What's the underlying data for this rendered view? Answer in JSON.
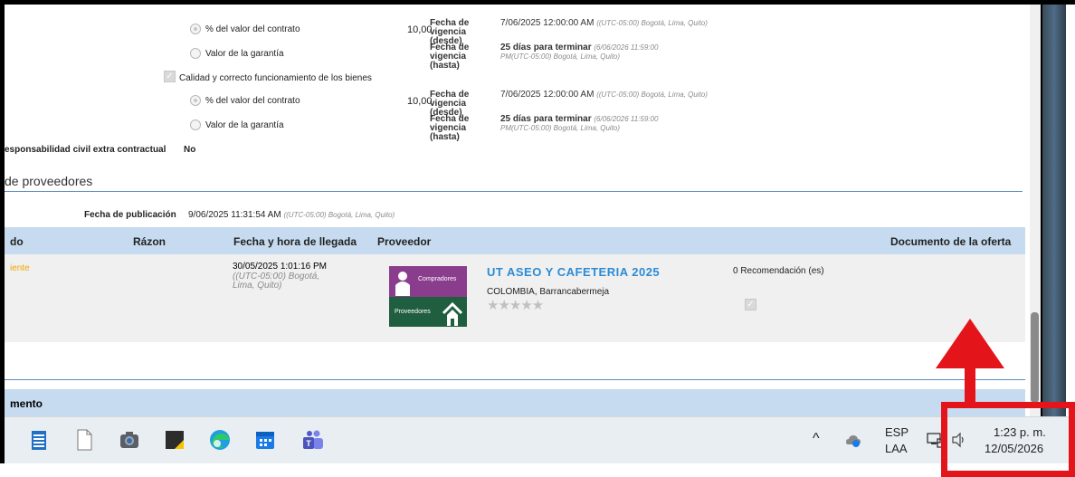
{
  "guarantees": {
    "block1": {
      "opt1_label": "% del valor del contrato",
      "opt2_label": "Valor de la garantía",
      "value": "10,00",
      "from_label": "Fecha de vigencia (desde)",
      "from_date": "7/06/2025 12:00:00 AM",
      "from_tz": "((UTC-05:00) Bogotá, Lima, Quito)",
      "to_label": "Fecha de vigencia (hasta)",
      "to_value": "25 días para terminar",
      "to_note": "(6/06/2026 11:59:00 PM(UTC-05:00) Bogotá, Lima, Quito)"
    },
    "quality_label": "Calidad y correcto funcionamiento de los bienes",
    "block2": {
      "opt1_label": "% del valor del contrato",
      "opt2_label": "Valor de la garantía",
      "value": "10,00",
      "from_label": "Fecha de vigencia (desde)",
      "from_date": "7/06/2025 12:00:00 AM",
      "from_tz": "((UTC-05:00) Bogotá, Lima, Quito)",
      "to_label": "Fecha de vigencia (hasta)",
      "to_value": "25 días para terminar",
      "to_note": "(6/06/2026 11:59:00 PM(UTC-05:00) Bogotá, Lima, Quito)"
    },
    "civil_label": "esponsabilidad civil extra contractual",
    "civil_value": "No"
  },
  "providers": {
    "section_title": "de proveedores",
    "publication_label": "Fecha de publicación",
    "publication_date": "9/06/2025 11:31:54 AM",
    "publication_tz": "((UTC-05:00) Bogotá, Lima, Quito)",
    "columns": [
      "do",
      "Rázon",
      "Fecha y hora de llegada",
      "Proveedor",
      "Documento de la oferta"
    ],
    "row": {
      "status": "iente",
      "arrival_date": "30/05/2025 1:01:16 PM",
      "arrival_tz": "((UTC-05:00) Bogotá, Lima, Quito)",
      "logo_top": "Compradores",
      "logo_bottom": "Proveedores",
      "supplier_name": "UT ASEO Y CAFETERIA 2025",
      "supplier_location": "COLOMBIA, Barrancabermeja",
      "recommendations": "0 Recomendación (es)"
    }
  },
  "lower_section_title": "mento",
  "taskbar": {
    "lang_top": "ESP",
    "lang_bottom": "LAA",
    "time": "1:23 p. m.",
    "date": "12/05/2026",
    "icons": [
      "notepad-icon",
      "blank-file-icon",
      "camera-icon",
      "sticky-notes-icon",
      "edge-icon",
      "calendar-icon",
      "teams-icon"
    ]
  },
  "colors": {
    "accent_blue": "#2a8bd6",
    "header_bg": "#c6dbf0",
    "status_orange": "#f0a800",
    "highlight_red": "#e4141b"
  }
}
